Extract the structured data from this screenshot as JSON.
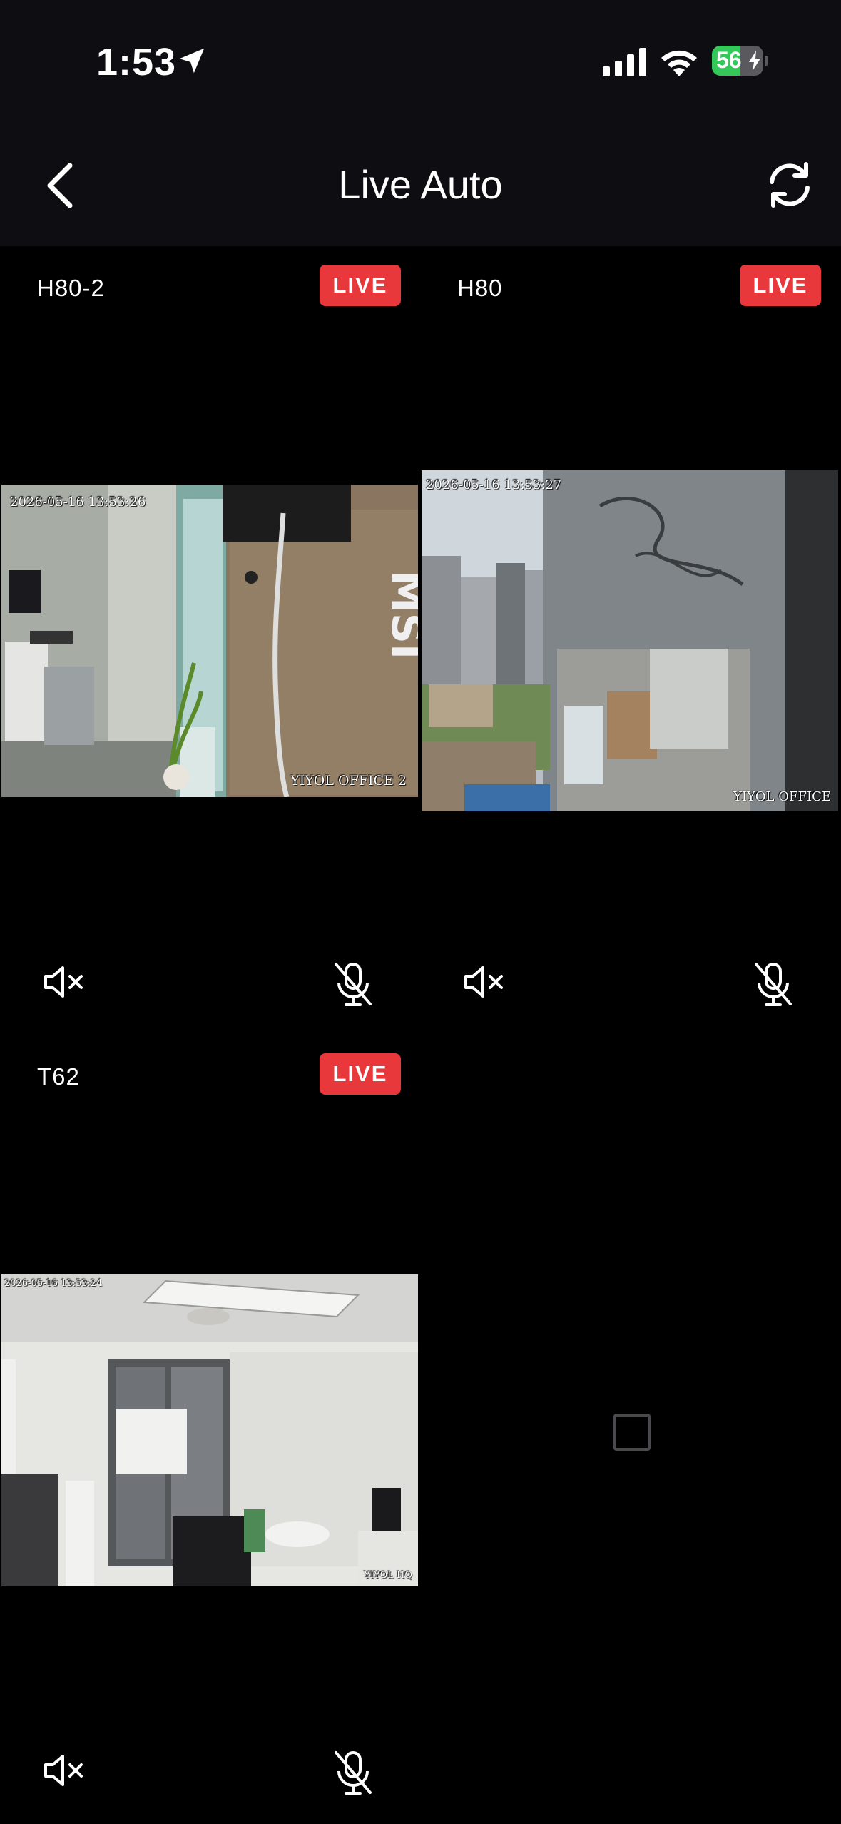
{
  "status_bar": {
    "time": "1:53",
    "battery": "56",
    "battery_level": 0.56
  },
  "nav": {
    "title": "Live Auto"
  },
  "colors": {
    "live_badge": "#e8383c",
    "nav_bg": "#0d0d12",
    "battery_green": "#34c759"
  },
  "cameras": [
    {
      "name": "H80-2",
      "badge": "LIVE",
      "timestamp": "2026-05-16 13:53:26",
      "watermark": "YIYOL OFFICE 2",
      "audio": "muted",
      "mic": "off"
    },
    {
      "name": "H80",
      "badge": "LIVE",
      "timestamp": "2026-05-16 13:53:27",
      "watermark": "YIYOL OFFICE",
      "audio": "muted",
      "mic": "off"
    },
    {
      "name": "T62",
      "badge": "LIVE",
      "timestamp": "2026-05-16 13:53:24",
      "watermark": "YIYOL HQ",
      "audio": "muted",
      "mic": "off"
    }
  ],
  "empty_slot": {
    "icon": "square-icon"
  }
}
